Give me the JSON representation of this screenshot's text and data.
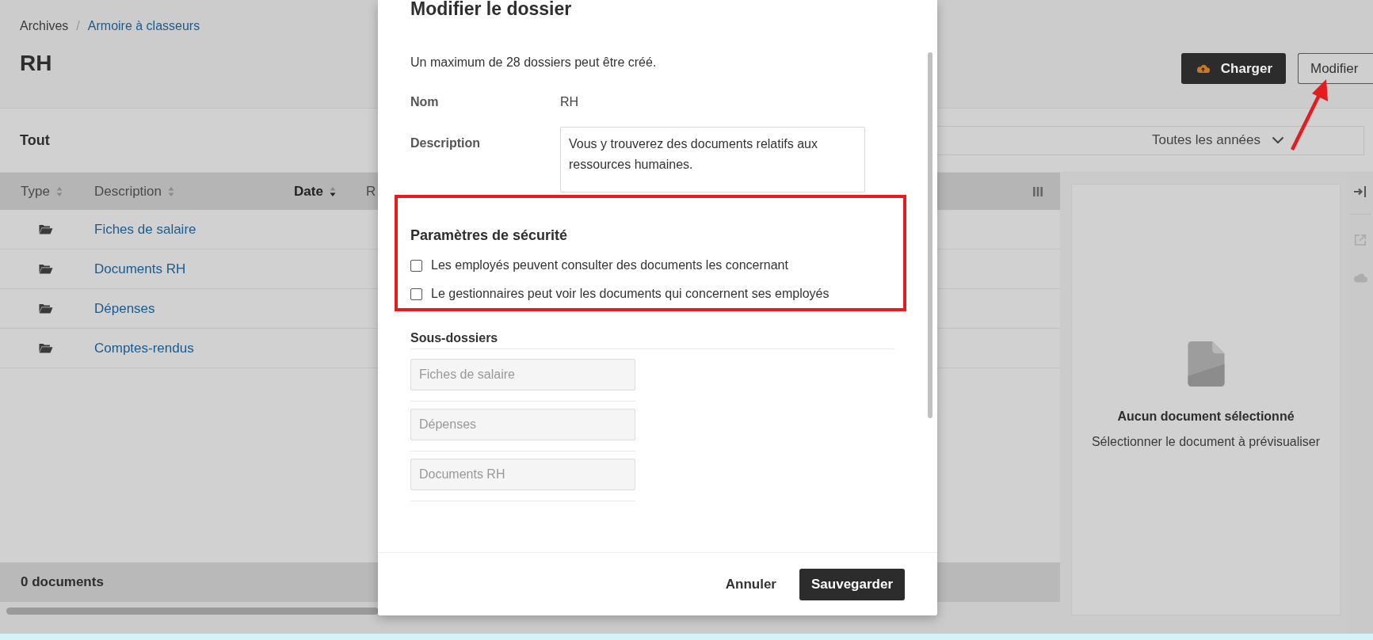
{
  "breadcrumb": {
    "separator": "/",
    "items": [
      {
        "label": "Archives",
        "link": false
      },
      {
        "label": "Armoire à classeurs",
        "link": true
      }
    ]
  },
  "page_title": "RH",
  "actions": [
    {
      "label": "Charger",
      "kind": "primary"
    },
    {
      "label": "Modifier",
      "kind": "secondary"
    }
  ],
  "filter": {
    "label": "Tout",
    "year_dropdown": "Toutes les années"
  },
  "table": {
    "columns": [
      {
        "label": "Type",
        "sorted": false
      },
      {
        "label": "Description",
        "sorted": false
      },
      {
        "label": "Date",
        "sorted": true
      },
      {
        "label": "R",
        "sorted": false
      }
    ],
    "rows": [
      {
        "description": "Fiches de salaire"
      },
      {
        "description": "Documents RH"
      },
      {
        "description": "Dépenses"
      },
      {
        "description": "Comptes-rendus"
      }
    ],
    "footer": "0 documents"
  },
  "preview": {
    "title": "Aucun document sélectionné",
    "hint": "Sélectionner le document à prévisualiser"
  },
  "modal": {
    "title": "Modifier le dossier",
    "info": "Un maximum de 28 dossiers peut être créé.",
    "fields": [
      {
        "label": "Nom",
        "value": "RH",
        "kind": "text"
      },
      {
        "label": "Description",
        "value": "Vous y trouverez des documents relatifs aux ressources humaines.",
        "kind": "textarea"
      }
    ],
    "security": {
      "title": "Paramètres de sécurité",
      "options": [
        {
          "label": "Les employés peuvent consulter des documents les concernant",
          "checked": false
        },
        {
          "label": "Le gestionnaires peut voir les documents qui concernent ses employés",
          "checked": false
        }
      ]
    },
    "subfolders": {
      "title": "Sous-dossiers",
      "items": [
        {
          "placeholder": "Fiches de salaire"
        },
        {
          "placeholder": "Dépenses"
        },
        {
          "placeholder": "Documents RH"
        }
      ]
    },
    "buttons": [
      {
        "label": "Annuler",
        "kind": "link"
      },
      {
        "label": "Sauvegarder",
        "kind": "primary"
      }
    ]
  }
}
